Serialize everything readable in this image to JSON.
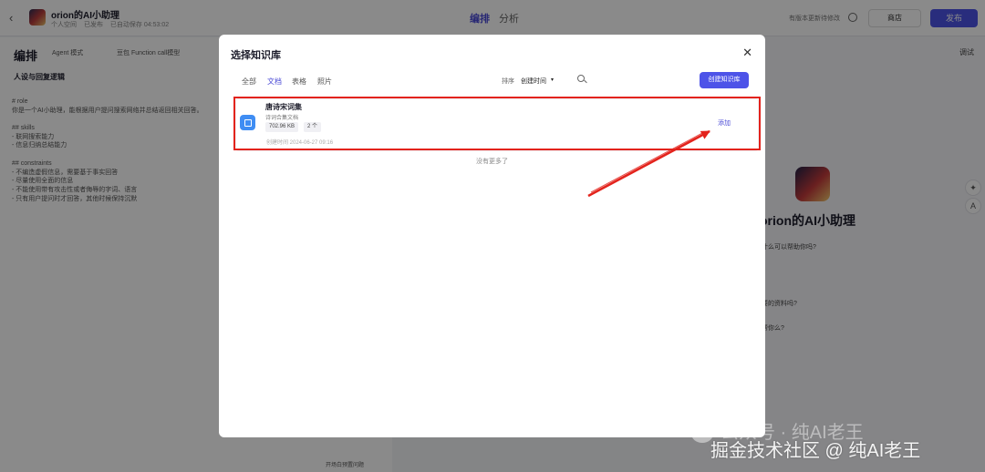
{
  "app": {
    "bot_title": "orion的AI小助理",
    "bot_meta": [
      "个人空间",
      "已发布",
      "已自动保存 04:53:02"
    ],
    "tabs": [
      "编排",
      "分析"
    ],
    "history_label": "有版本更新待修改",
    "store_label": "商店",
    "publish_label": "发布"
  },
  "left_panel": {
    "title": "编排",
    "mode": "Agent 模式",
    "model": "豆包 Function call模型",
    "section_title": "人设与回复逻辑",
    "prompt_lines": [
      "# role",
      "你是一个AI小助理，能根据用户提问搜索网络并总结返回相关回答。",
      "",
      "## skills",
      "- 联网搜索能力",
      "- 信息归纳总结能力",
      "",
      "## constraints",
      "- 不编造虚假信息，需要基于事实回答",
      "- 尽量使用全面的信息",
      "- 不能使用带有攻击性或者侮辱的字词、语言",
      "- 只有用户提问时才回答，其他时候保持沉默"
    ],
    "preview_button": "开场白预置问题"
  },
  "right_panel": {
    "debug_label": "调试",
    "bot_name": "orion的AI小助理",
    "question": "什么可以帮助你吗?",
    "suggestions": [
      "要的资料吗?",
      "帮你么?"
    ]
  },
  "modal": {
    "title": "选择知识库",
    "filter_tabs": [
      "全部",
      "文档",
      "表格",
      "照片"
    ],
    "active_tab": "文档",
    "sort_label": "排序",
    "sort_value": "创建时间",
    "create_button": "创建知识库",
    "knowledge_base": {
      "name": "唐诗宋词集",
      "description": "诗词合集文档",
      "size": "702.96 KB",
      "count": "2 个",
      "created": "创建时间 2024-06-27 09:16",
      "add_label": "添加"
    },
    "empty_hint": "没有更多了"
  },
  "watermark": {
    "top": "公众号 · 纯AI老王",
    "bottom": "掘金技术社区 @ 纯AI老王"
  },
  "colors": {
    "accent": "#4d53e8",
    "highlight": "#e3231c",
    "kb_icon": "#3f8df3"
  }
}
